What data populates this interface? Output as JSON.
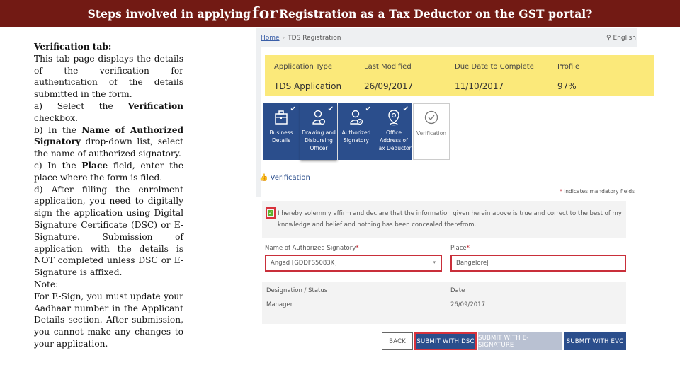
{
  "slide": {
    "title_part1": "Steps involved in applying",
    "title_emph": "for",
    "title_part2": "Registration as a Tax Deductor on the GST portal?"
  },
  "instructions": {
    "heading": "Verification tab:",
    "intro": "This tab page displays the details of the verification for authentication of the details submitted in the form.",
    "step_a_pre": "a) Select the",
    "step_a_bold": "Verification",
    "step_a_post": "checkbox.",
    "step_b_pre": "b) In the",
    "step_b_bold": "Name of Authorized Signatory",
    "step_b_post": "drop-down list, select the name of authorized signatory.",
    "step_c_pre": "c) In the",
    "step_c_bold": "Place",
    "step_c_post": "field, enter the place where the form is filed.",
    "step_d": "d) After filling the enrolment application, you need to digitally sign the application using Digital Signature Certificate (DSC) or E-Signature. Submission of application with the details is NOT completed unless DSC or E-Signature is affixed.",
    "note_label": "Note:",
    "note_text": "For E-Sign, you must update your Aadhaar number in the Applicant Details section. After submission, you cannot make any changes to your application."
  },
  "portal": {
    "breadcrumb": {
      "home": "Home",
      "current": "TDS Registration"
    },
    "language": "English",
    "summary": {
      "headers": [
        "Application Type",
        "Last Modified",
        "Due Date to Complete",
        "Profile"
      ],
      "values": [
        "TDS Application",
        "26/09/2017",
        "11/10/2017",
        "97%"
      ]
    },
    "colors": {
      "primary": "#2b4e8c",
      "highlight": "#fbe97a",
      "error": "#c92f3a",
      "success": "#5ab12b"
    },
    "steps": [
      {
        "label": "Business Details",
        "icon": "briefcase-icon",
        "done": true
      },
      {
        "label": "Drawing and Disbursing Officer",
        "icon": "user-icon",
        "done": true
      },
      {
        "label": "Authorized Signatory",
        "icon": "user-check-icon",
        "done": true
      },
      {
        "label": "Office Address of Tax Deductor",
        "icon": "location-pin-icon",
        "done": true
      },
      {
        "label": "Verification",
        "icon": "check-circle-icon",
        "done": false
      }
    ],
    "verification_heading": "Verification",
    "mandatory_note": "indicates mandatory fields",
    "declaration": "I hereby solemnly affirm and declare that the information given herein above is true and correct to the best of my knowledge and belief and nothing has been concealed therefrom.",
    "declaration_checked": true,
    "signatory_label": "Name of Authorized Signatory",
    "signatory_value": "Angad [GDDFS5083K]",
    "place_label": "Place",
    "place_value": "Bangelore",
    "designation_label": "Designation / Status",
    "designation_value": "Manager",
    "date_label": "Date",
    "date_value": "26/09/2017",
    "buttons": {
      "back": "BACK",
      "dsc": "SUBMIT WITH DSC",
      "esign": "SUBMIT WITH E-SIGNATURE",
      "evc": "SUBMIT WITH EVC"
    }
  }
}
